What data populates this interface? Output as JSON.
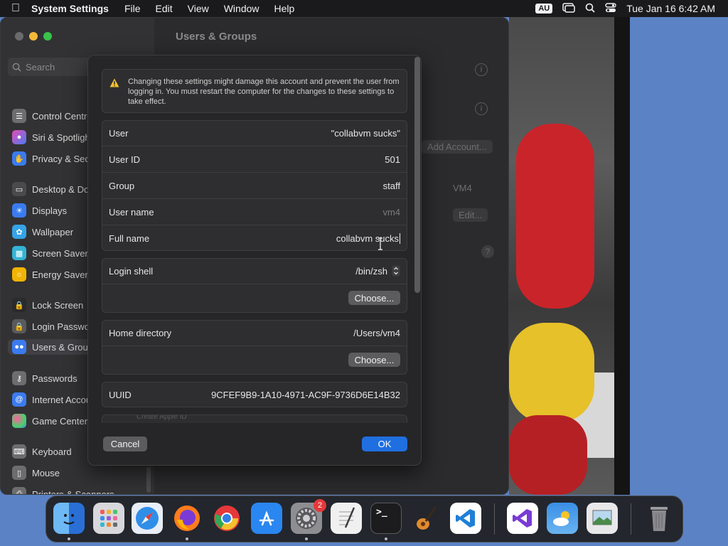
{
  "menubar": {
    "app_name": "System Settings",
    "menus": [
      "File",
      "Edit",
      "View",
      "Window",
      "Help"
    ],
    "input_source": "AU",
    "datetime": "Tue Jan 16  6:42 AM"
  },
  "sidebar": {
    "search_placeholder": "Search",
    "items": [
      {
        "label": "Control Centre",
        "icon": "control-centre-icon",
        "color": "#6d6d70"
      },
      {
        "label": "Siri & Spotlight",
        "icon": "siri-icon",
        "color": "#9b4fd1"
      },
      {
        "label": "Privacy & Security",
        "icon": "hand-icon",
        "color": "#3a7bf0"
      },
      {
        "label": "Desktop & Dock",
        "icon": "desktop-icon",
        "color": "#5a5a5c"
      },
      {
        "label": "Displays",
        "icon": "sun-icon",
        "color": "#3a7bf0"
      },
      {
        "label": "Wallpaper",
        "icon": "wallpaper-icon",
        "color": "#35a3e6"
      },
      {
        "label": "Screen Saver",
        "icon": "screensaver-icon",
        "color": "#34b3d6"
      },
      {
        "label": "Energy Saver",
        "icon": "bulb-icon",
        "color": "#f2b400"
      },
      {
        "label": "Lock Screen",
        "icon": "lock-icon",
        "color": "#2a2a2c"
      },
      {
        "label": "Login Password",
        "icon": "lock-icon",
        "color": "#5a5a5c"
      },
      {
        "label": "Users & Groups",
        "icon": "users-icon",
        "color": "#3a7bf0"
      },
      {
        "label": "Passwords",
        "icon": "key-icon",
        "color": "#6d6d70"
      },
      {
        "label": "Internet Accounts",
        "icon": "at-icon",
        "color": "#3a7bf0"
      },
      {
        "label": "Game Center",
        "icon": "game-center-icon",
        "color": "#e0e0e0"
      },
      {
        "label": "Keyboard",
        "icon": "keyboard-icon",
        "color": "#6d6d70"
      },
      {
        "label": "Mouse",
        "icon": "mouse-icon",
        "color": "#6d6d70"
      },
      {
        "label": "Printers & Scanners",
        "icon": "printer-icon",
        "color": "#6d6d70"
      }
    ]
  },
  "content": {
    "title": "Users & Groups",
    "add_account_label": "Add Account...",
    "vm4_label": "VM4",
    "edit_label": "Edit..."
  },
  "dialog": {
    "warning_text": "Changing these settings might damage this account and prevent the user from logging in. You must restart the computer for the changes to these settings to take effect.",
    "user_label": "User",
    "user_value": "\"collabvm sucks\"",
    "user_id_label": "User ID",
    "user_id_value": "501",
    "group_label": "Group",
    "group_value": "staff",
    "user_name_label": "User name",
    "user_name_value": "vm4",
    "full_name_label": "Full name",
    "full_name_value": "collabvm sucks",
    "login_shell_label": "Login shell",
    "login_shell_value": "/bin/zsh",
    "choose_label": "Choose...",
    "home_dir_label": "Home directory",
    "home_dir_value": "/Users/vm4",
    "uuid_label": "UUID",
    "uuid_value": "9CFEF9B9-1A10-4971-AC9F-9736D6E14B32",
    "apple_id_label": "Create Apple ID",
    "cancel_label": "Cancel",
    "ok_label": "OK"
  },
  "dock": {
    "badge_count": "2",
    "apps": [
      {
        "name": "finder-icon",
        "color": "#3d8cf0"
      },
      {
        "name": "launchpad-icon",
        "color": "#d8d8dc"
      },
      {
        "name": "safari-icon",
        "color": "#2f8ee8"
      },
      {
        "name": "firefox-icon",
        "color": "#ff7b1c"
      },
      {
        "name": "chrome-icon",
        "color": "#e6e6e6"
      },
      {
        "name": "app-store-icon",
        "color": "#2a86f0"
      },
      {
        "name": "system-settings-icon",
        "color": "#8e8e92"
      },
      {
        "name": "textedit-icon",
        "color": "#f0f0f0"
      },
      {
        "name": "terminal-icon",
        "color": "#1c1c1e"
      },
      {
        "name": "garageband-icon",
        "color": "#2a2a2c"
      },
      {
        "name": "vscode-icon",
        "color": "#ffffff"
      },
      {
        "name": "visual-studio-icon",
        "color": "#ffffff"
      },
      {
        "name": "weather-icon",
        "color": "#3a8ee6"
      },
      {
        "name": "preview-icon",
        "color": "#e8e8ea"
      },
      {
        "name": "trash-icon",
        "color": "#8a8a8e"
      }
    ]
  }
}
